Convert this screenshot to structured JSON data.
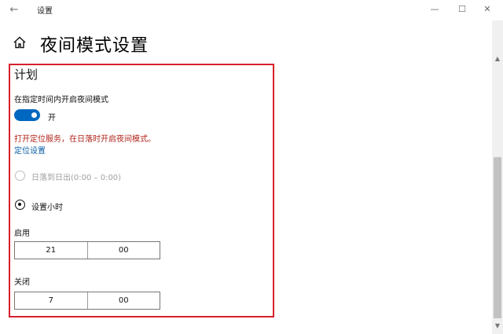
{
  "window": {
    "title": "设置",
    "back_icon": "←",
    "minimize_icon": "—",
    "maximize_icon": "☐",
    "close_icon": "✕"
  },
  "page": {
    "title": "夜间模式设置",
    "home_icon": "home-icon"
  },
  "schedule": {
    "section_title": "计划",
    "toggle_label": "在指定时间内开启夜间模式",
    "toggle_on": true,
    "toggle_state": "开",
    "warning": "打开定位服务，在日落时开启夜间模式。",
    "location_link": "定位设置",
    "options": {
      "sunset": {
        "label": "日落到日出(0:00 – 0:00)",
        "selected": false,
        "disabled": true
      },
      "custom": {
        "label": "设置小时",
        "selected": true
      }
    },
    "start": {
      "label": "启用",
      "hour": "21",
      "minute": "00"
    },
    "end": {
      "label": "关闭",
      "hour": "7",
      "minute": "00"
    }
  },
  "colors": {
    "accent": "#0067c0",
    "highlight_border": "#d6202b",
    "warning": "#b1241b",
    "link": "#0a5ea8"
  }
}
